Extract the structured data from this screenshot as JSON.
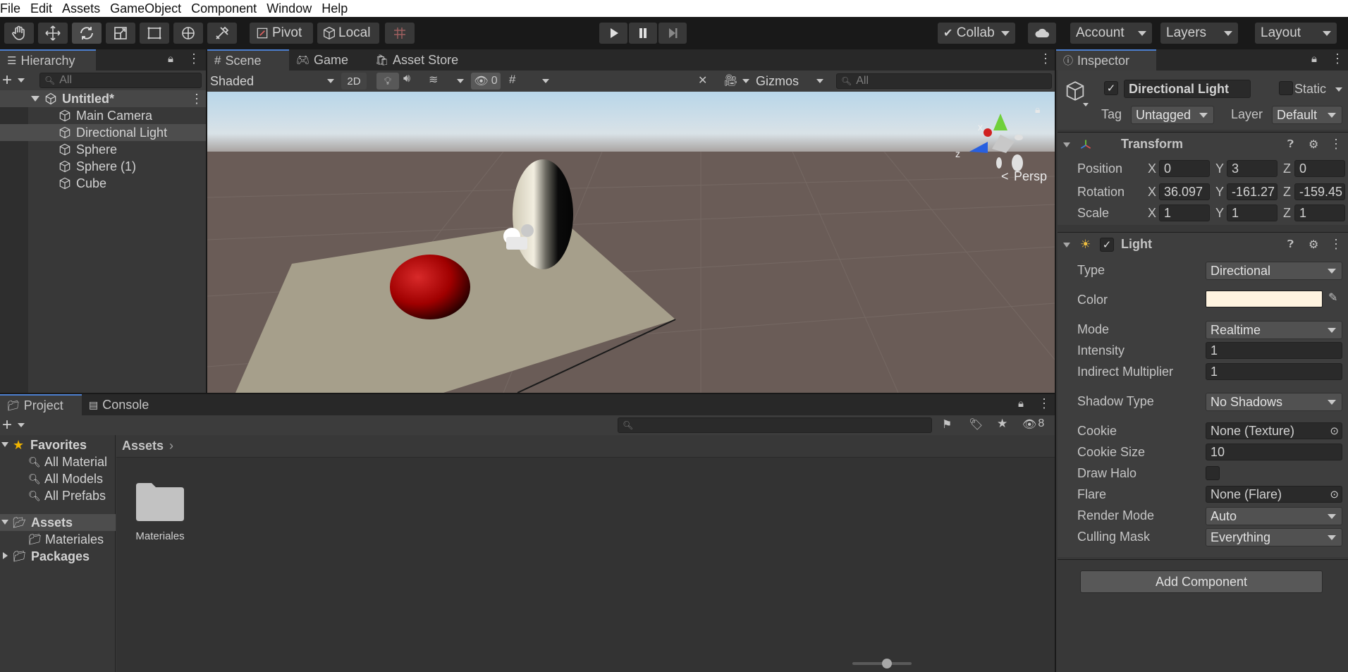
{
  "menu": [
    "File",
    "Edit",
    "Assets",
    "GameObject",
    "Component",
    "Window",
    "Help"
  ],
  "toolbar": {
    "pivot": "Pivot",
    "local": "Local",
    "collab": "Collab",
    "account": "Account",
    "layers": "Layers",
    "layout": "Layout"
  },
  "hierarchy": {
    "tab": "Hierarchy",
    "search_placeholder": "All",
    "scene": "Untitled*",
    "items": [
      "Main Camera",
      "Directional Light",
      "Sphere",
      "Sphere (1)",
      "Cube"
    ]
  },
  "scene": {
    "tabs": [
      "Scene",
      "Game",
      "Asset Store"
    ],
    "shading": "Shaded",
    "mode2d": "2D",
    "hidden_count": "0",
    "gizmos": "Gizmos",
    "search_placeholder": "All",
    "persp": "Persp",
    "axis_x": "x",
    "axis_z": "z"
  },
  "project": {
    "tabs": [
      "Project",
      "Console"
    ],
    "hidden_count": "8",
    "favorites_label": "Favorites",
    "favorites": [
      "All Material",
      "All Models",
      "All Prefabs"
    ],
    "assets_label": "Assets",
    "assets_children": [
      "Materiales"
    ],
    "packages_label": "Packages",
    "breadcrumb": "Assets",
    "folder_items": [
      "Materiales"
    ]
  },
  "inspector": {
    "tab": "Inspector",
    "object_name": "Directional Light",
    "static_label": "Static",
    "tag_label": "Tag",
    "tag_value": "Untagged",
    "layer_label": "Layer",
    "layer_value": "Default",
    "transform": {
      "title": "Transform",
      "position_label": "Position",
      "rotation_label": "Rotation",
      "scale_label": "Scale",
      "axes": [
        "X",
        "Y",
        "Z"
      ],
      "position": [
        "0",
        "3",
        "0"
      ],
      "rotation": [
        "36.097",
        "-161.27",
        "-159.45"
      ],
      "scale": [
        "1",
        "1",
        "1"
      ]
    },
    "light": {
      "title": "Light",
      "type_label": "Type",
      "type_value": "Directional",
      "color_label": "Color",
      "color_value": "#fff4e0",
      "mode_label": "Mode",
      "mode_value": "Realtime",
      "intensity_label": "Intensity",
      "intensity_value": "1",
      "indirect_label": "Indirect Multiplier",
      "indirect_value": "1",
      "shadow_label": "Shadow Type",
      "shadow_value": "No Shadows",
      "cookie_label": "Cookie",
      "cookie_value": "None (Texture)",
      "cookie_size_label": "Cookie Size",
      "cookie_size_value": "10",
      "halo_label": "Draw Halo",
      "flare_label": "Flare",
      "flare_value": "None (Flare)",
      "render_mode_label": "Render Mode",
      "render_mode_value": "Auto",
      "culling_label": "Culling Mask",
      "culling_value": "Everything"
    },
    "add_component": "Add Component"
  },
  "colors": {
    "accent": "#4c7fcf",
    "selection": "#2c5d87",
    "sky": "#b8d6e9",
    "ground": "#6a5c57",
    "plane": "#a69f8b",
    "red_sphere": "#c41010"
  }
}
